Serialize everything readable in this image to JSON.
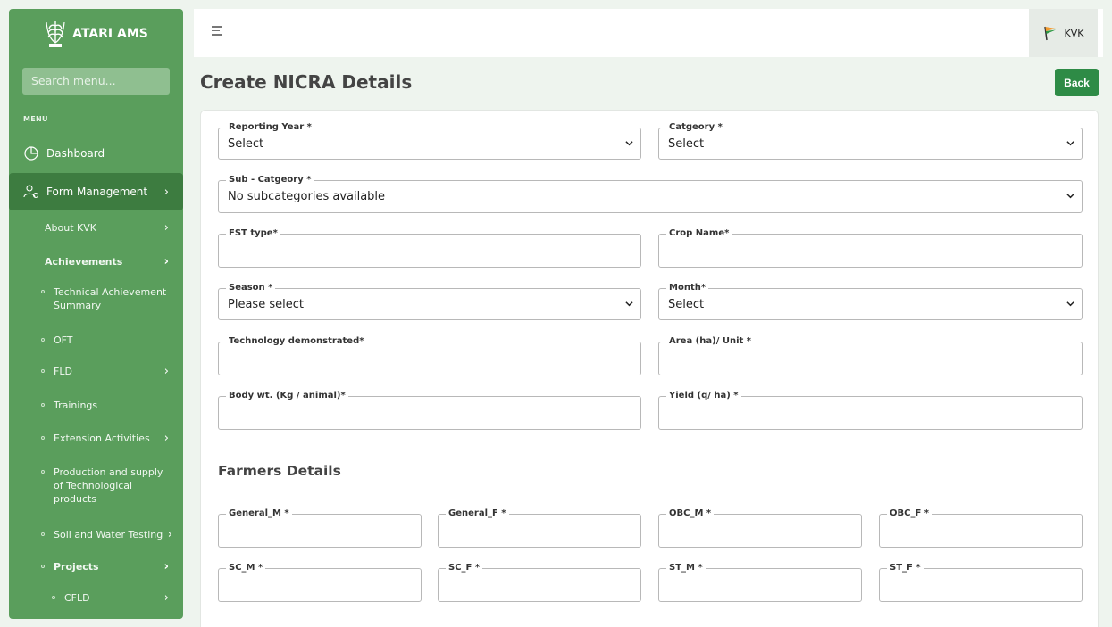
{
  "sidebar": {
    "brand": "ATARI AMS",
    "search_placeholder": "Search menu...",
    "menu_heading": "MENU",
    "dashboard": "Dashboard",
    "form_management": "Form Management",
    "about_kvk": "About KVK",
    "achievements": "Achievements",
    "technical_achievement_summary": "Technical Achievement Summary",
    "oft": "OFT",
    "fld": "FLD",
    "trainings": "Trainings",
    "extension_activities": "Extension Activities",
    "production_supply": "Production and supply of Technological products",
    "soil_water_testing": "Soil and Water Testing",
    "projects": "Projects",
    "cfld": "CFLD"
  },
  "topbar": {
    "user_label": "KVK"
  },
  "page": {
    "title": "Create NICRA Details",
    "back_label": "Back"
  },
  "form": {
    "reporting_year": {
      "label": "Reporting Year *",
      "value": "Select"
    },
    "category": {
      "label": "Catgeory *",
      "value": "Select"
    },
    "sub_category": {
      "label": "Sub - Catgeory *",
      "value": "No subcategories available"
    },
    "fst_type": {
      "label": "FST type*"
    },
    "crop_name": {
      "label": "Crop Name*"
    },
    "season": {
      "label": "Season *",
      "value": "Please select"
    },
    "month": {
      "label": "Month*",
      "value": "Select"
    },
    "technology": {
      "label": "Technology demonstrated*"
    },
    "area": {
      "label": "Area (ha)/ Unit *"
    },
    "body_wt": {
      "label": "Body wt. (Kg / animal)*"
    },
    "yield": {
      "label": "Yield (q/ ha) *"
    },
    "farmers_title": "Farmers Details",
    "general_m": "General_M *",
    "general_f": "General_F *",
    "obc_m": "OBC_M *",
    "obc_f": "OBC_F *",
    "sc_m": "SC_M *",
    "sc_f": "SC_F *",
    "st_m": "ST_M *",
    "st_f": "ST_F *"
  },
  "colors": {
    "sidebar": "#5a9e5c",
    "sidebar_active": "#3d7c40",
    "primary_button": "#2e8b46"
  },
  "icons": {
    "dashboard": "pie-chart-icon",
    "form_management": "users-gear-icon",
    "menu_toggle": "hamburger-icon",
    "flag": "india-flag-icon"
  }
}
